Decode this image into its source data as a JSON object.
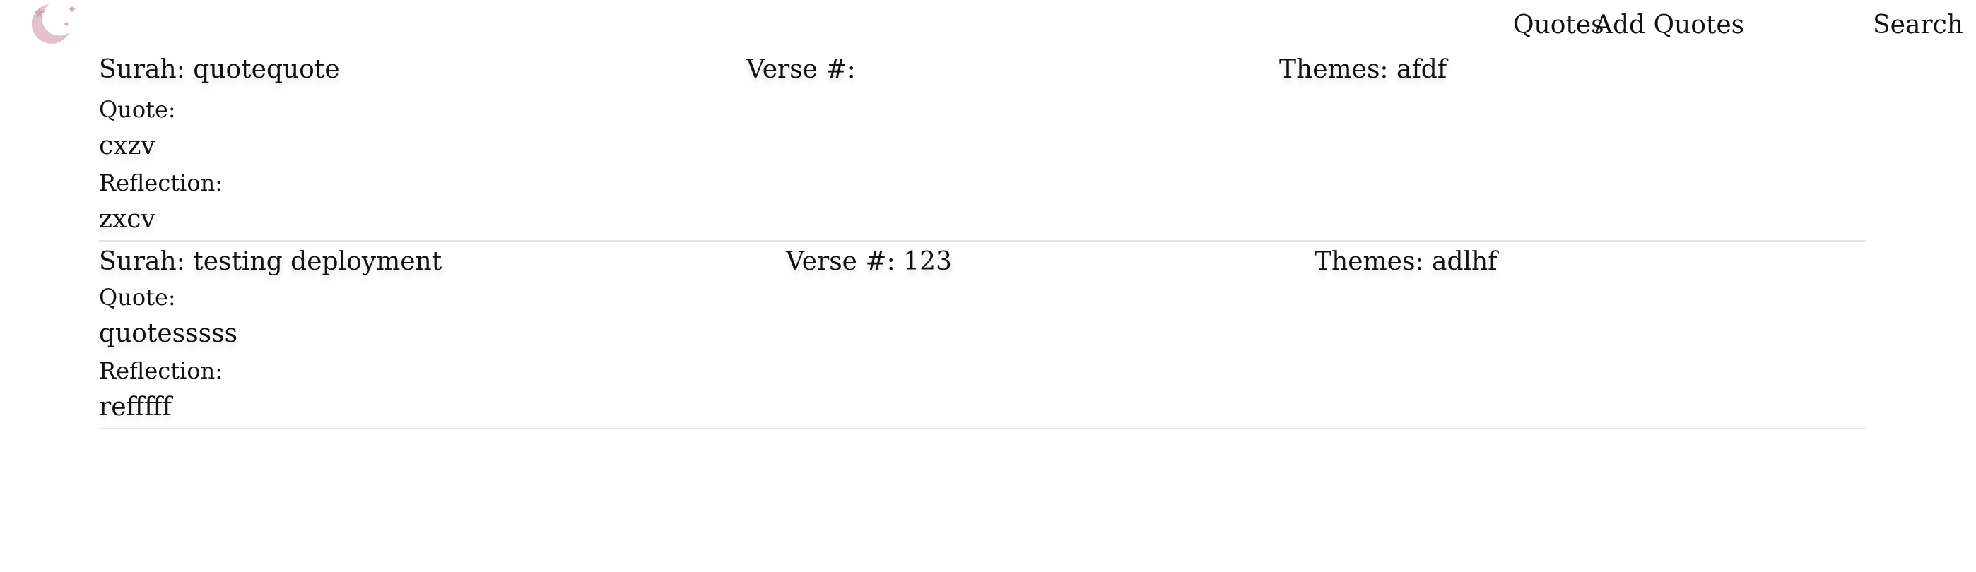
{
  "nav": {
    "quotes": "Quotes",
    "add_quotes": "Add Quotes",
    "search": "Search"
  },
  "logo": {
    "icon": "moon-stars-icon",
    "color": "#d8a8b6"
  },
  "entries": [
    {
      "surah": "Surah: quotequote",
      "verse": "Verse #:",
      "themes": "Themes: afdf",
      "quote_label": "Quote:",
      "quote": "cxzv",
      "reflection_label": "Reflection:",
      "reflection": "zxcv"
    },
    {
      "surah": "Surah: testing deployment",
      "verse": "Verse #: 123",
      "themes": "Themes: adlhf",
      "quote_label": "Quote:",
      "quote": "quotesssss",
      "reflection_label": "Reflection:",
      "reflection": "refffff"
    }
  ]
}
